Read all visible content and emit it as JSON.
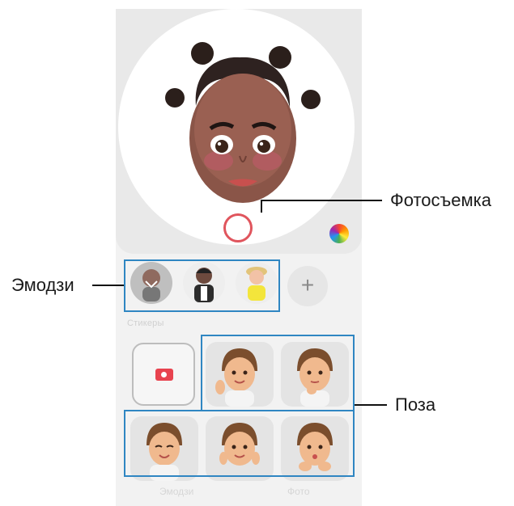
{
  "callouts": {
    "photo": "Фотосъемка",
    "emoji": "Эмодзи",
    "pose": "Поза"
  },
  "emoji_row": {
    "add_button": "+",
    "sublabel": "Стикеры"
  },
  "tabs": [
    "Эмодзи",
    "Фото"
  ],
  "colors": {
    "accent_blue": "#2f86c2",
    "shutter_red": "#e0555d"
  }
}
